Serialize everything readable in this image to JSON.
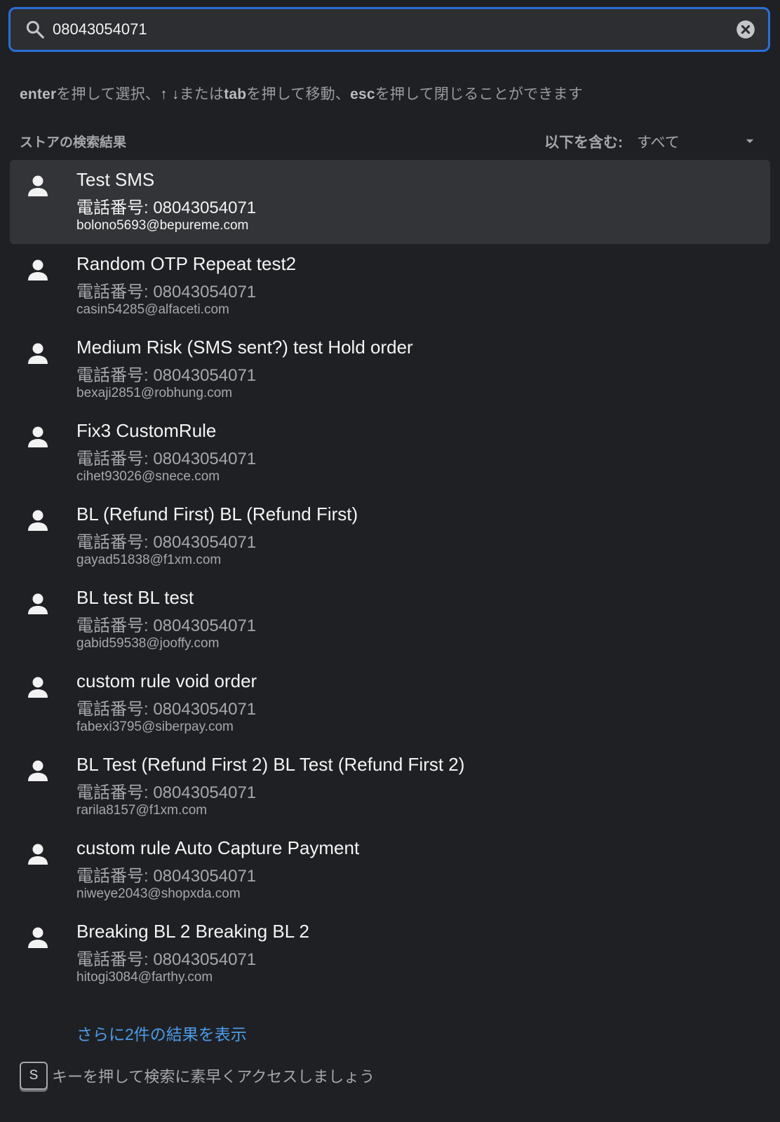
{
  "search": {
    "value": "08043054071",
    "search_icon": "search-icon",
    "clear_icon": "clear-circle-icon"
  },
  "hint": {
    "k1": "enter",
    "t1": "を押して選択、",
    "arrows": "↑ ↓",
    "t2": "または",
    "k2": "tab",
    "t3": "を押して移動、",
    "k3": "esc",
    "t4": "を押して閉じることができます"
  },
  "section": {
    "title": "ストアの検索結果",
    "filter_label": "以下を含む:",
    "filter_value": "すべて",
    "caret_icon": "caret-down-icon"
  },
  "results": [
    {
      "name": "Test SMS",
      "phone": "電話番号: 08043054071",
      "email": "bolono5693@bepureme.com",
      "icon": "person-icon",
      "selected": true
    },
    {
      "name": "Random OTP Repeat test2",
      "phone": "電話番号: 08043054071",
      "email": "casin54285@alfaceti.com",
      "icon": "person-icon"
    },
    {
      "name": "Medium Risk (SMS sent?) test Hold order",
      "phone": "電話番号: 08043054071",
      "email": "bexaji2851@robhung.com",
      "icon": "person-icon"
    },
    {
      "name": "Fix3 CustomRule",
      "phone": "電話番号: 08043054071",
      "email": "cihet93026@snece.com",
      "icon": "person-icon"
    },
    {
      "name": "BL (Refund First) BL (Refund First)",
      "phone": "電話番号: 08043054071",
      "email": "gayad51838@f1xm.com",
      "icon": "person-icon"
    },
    {
      "name": "BL test BL test",
      "phone": "電話番号: 08043054071",
      "email": "gabid59538@jooffy.com",
      "icon": "person-icon"
    },
    {
      "name": "custom rule void order",
      "phone": "電話番号: 08043054071",
      "email": "fabexi3795@siberpay.com",
      "icon": "person-icon"
    },
    {
      "name": "BL Test (Refund First 2) BL Test (Refund First 2)",
      "phone": "電話番号: 08043054071",
      "email": "rarila8157@f1xm.com",
      "icon": "person-icon"
    },
    {
      "name": "custom rule Auto Capture Payment",
      "phone": "電話番号: 08043054071",
      "email": "niweye2043@shopxda.com",
      "icon": "person-icon"
    },
    {
      "name": "Breaking BL 2 Breaking BL 2",
      "phone": "電話番号: 08043054071",
      "email": "hitogi3084@farthy.com",
      "icon": "person-icon"
    }
  ],
  "more_link": "さらに2件の結果を表示",
  "footer": {
    "key": "S",
    "text": "キーを押して検索に素早くアクセスしましょう"
  },
  "colors": {
    "background": "#1f2023",
    "focus_border": "#2a6fd6",
    "link": "#4c9be9",
    "selected_row": "#333437"
  }
}
